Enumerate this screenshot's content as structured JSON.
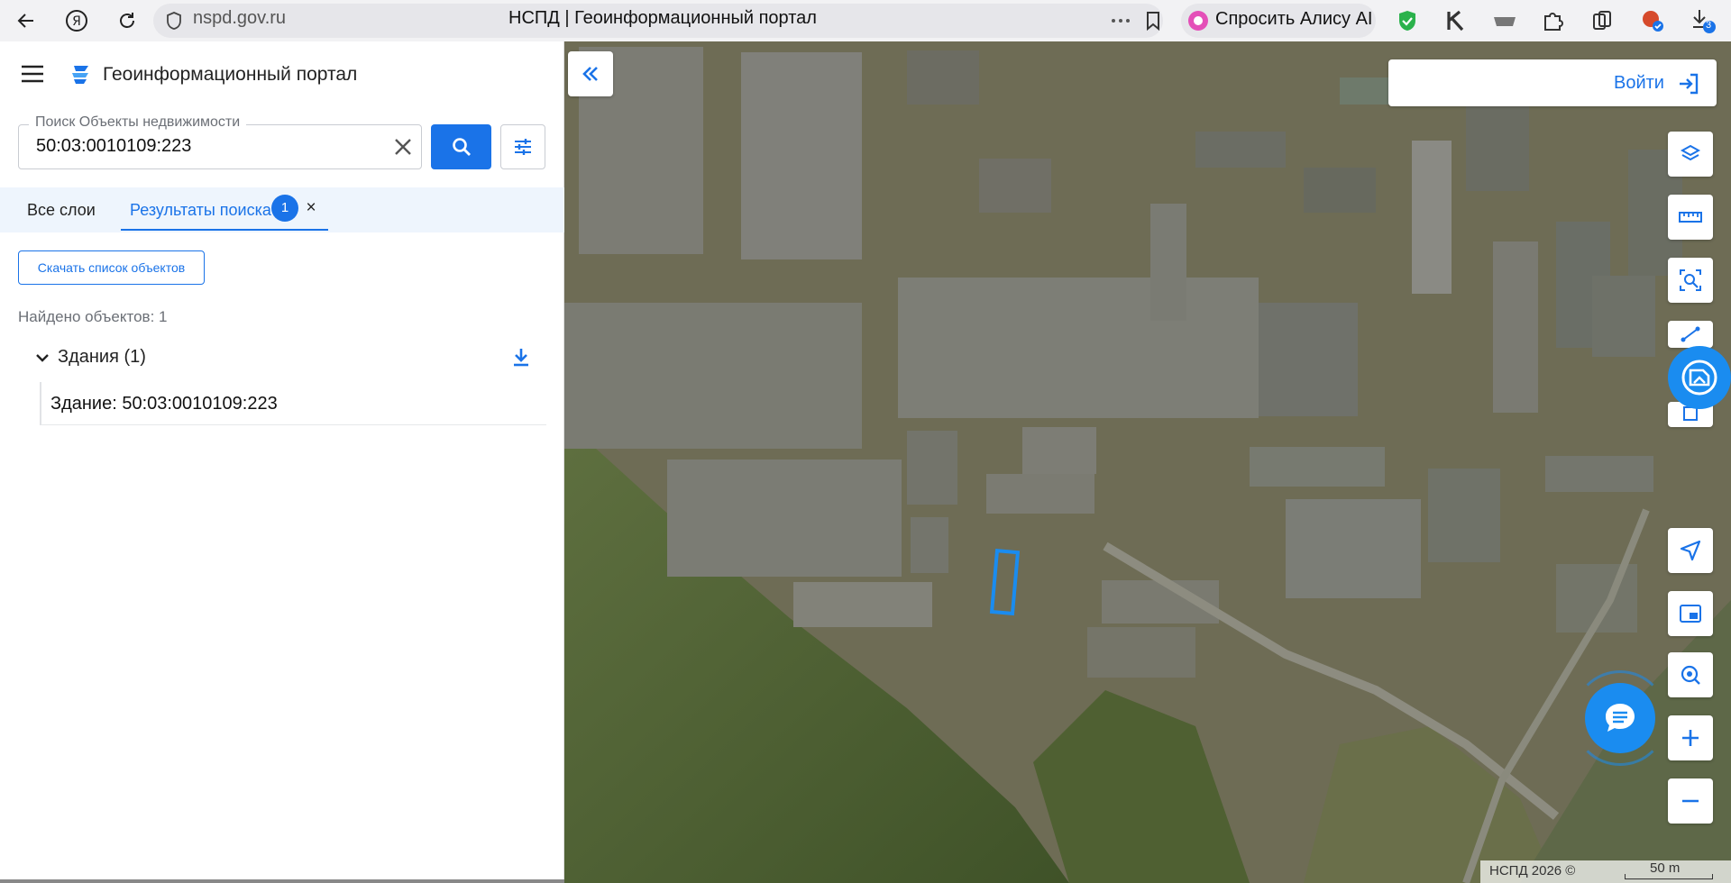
{
  "browser": {
    "url": "nspd.gov.ru",
    "tab_title": "НСПД | Геоинформационный портал",
    "alisa_label": "Спросить Алису AI",
    "downloads_count": "3"
  },
  "sidebar": {
    "app_title": "Геоинформационный портал",
    "search": {
      "label": "Поиск Объекты недвижимости",
      "value": "50:03:0010109:223"
    },
    "tabs": [
      {
        "label": "Все слои"
      },
      {
        "label": "Результаты поиска",
        "badge": "1"
      }
    ],
    "download_list_label": "Скачать список объектов",
    "found_text": "Найдено объектов: 1",
    "groups": [
      {
        "label": "Здания (1)",
        "items": [
          {
            "label": "Здание: 50:03:0010109:223"
          }
        ]
      }
    ]
  },
  "map": {
    "login_label": "Войти",
    "copyright": "НСПД 2026 ©",
    "scale_label": "50 m",
    "accent": "#1a73e8"
  }
}
